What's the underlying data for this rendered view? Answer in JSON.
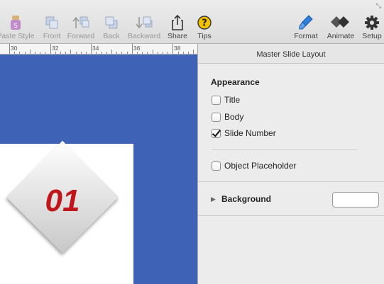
{
  "toolbar": {
    "paste_style": "Paste Style",
    "front": "Front",
    "forward": "Forward",
    "back": "Back",
    "backward": "Backward",
    "share": "Share",
    "tips": "Tips",
    "format": "Format",
    "animate": "Animate",
    "setup": "Setup"
  },
  "ruler": {
    "labels": [
      "30",
      "32",
      "34",
      "36",
      "38"
    ]
  },
  "slide": {
    "number": "01"
  },
  "inspector": {
    "title": "Master Slide Layout",
    "appearance": {
      "heading": "Appearance",
      "title_label": "Title",
      "body_label": "Body",
      "slide_number_label": "Slide Number"
    },
    "object_placeholder_label": "Object Placeholder",
    "background_label": "Background"
  },
  "state": {
    "title": false,
    "body": false,
    "slide_number": true,
    "object_placeholder": false
  },
  "colors": {
    "canvas": "#3e62b6",
    "slide_number": "#c0161b",
    "tips_icon": "#f2c200",
    "format_icon": "#2f7fd8"
  }
}
